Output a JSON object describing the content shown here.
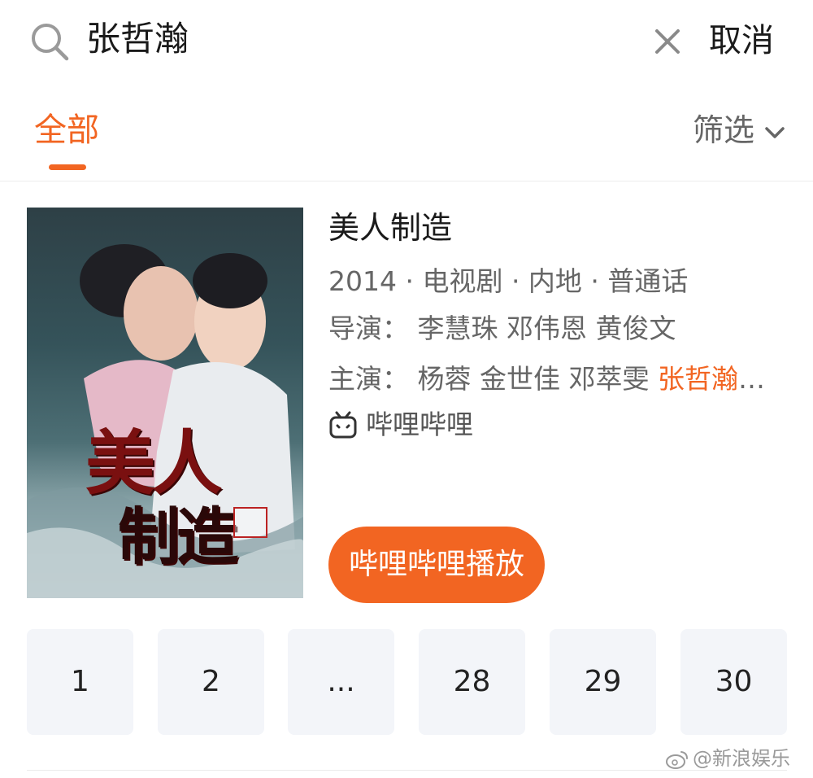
{
  "search": {
    "query": "张哲瀚",
    "cancel_label": "取消"
  },
  "tabs": {
    "active_label": "全部",
    "filter_label": "筛选"
  },
  "result": {
    "poster_title_line1": "美人",
    "poster_title_line2": "制造",
    "title": "美人制造",
    "meta": "2014 · 电视剧 · 内地 · 普通话",
    "director_line": "导演： 李慧珠 邓伟恩 黄俊文",
    "cast_prefix": "主演： 杨蓉 金世佳 邓萃雯 ",
    "cast_highlight": "张哲瀚",
    "cast_suffix": "…",
    "platform": "哔哩哔哩",
    "play_label": "哔哩哔哩播放"
  },
  "episodes": [
    "1",
    "2",
    "...",
    "28",
    "29",
    "30"
  ],
  "watermark": "@新浪娱乐",
  "colors": {
    "accent": "#f26522",
    "episode_bg": "#f3f5f9"
  }
}
